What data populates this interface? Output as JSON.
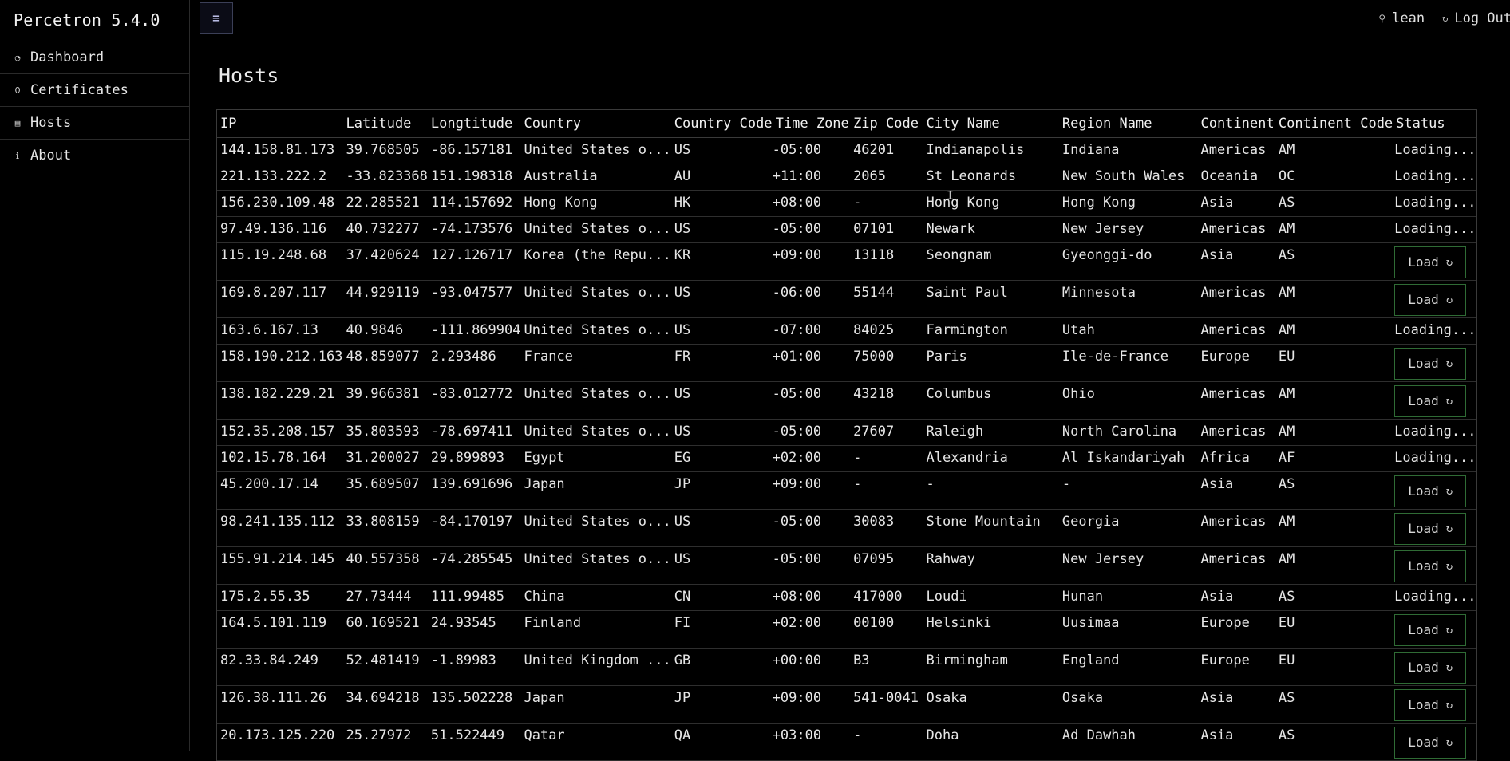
{
  "app": {
    "title": "Percetron 5.4.0"
  },
  "sidebar": {
    "items": [
      {
        "label": "Dashboard",
        "icon": "dashboard-icon"
      },
      {
        "label": "Certificates",
        "icon": "certificate-icon"
      },
      {
        "label": "Hosts",
        "icon": "list-icon"
      },
      {
        "label": "About",
        "icon": "info-icon"
      }
    ]
  },
  "header": {
    "menu_icon": "hamburger-icon",
    "username": "lean",
    "logout_label": "Log Out"
  },
  "page": {
    "title": "Hosts"
  },
  "table": {
    "columns": [
      "IP",
      "Latitude",
      "Longtitude",
      "Country",
      "Country Code",
      "Time Zone",
      "Zip Code",
      "City Name",
      "Region Name",
      "Continent",
      "Continent Code",
      "Status"
    ],
    "load_label": "Load",
    "loading_label": "Loading...",
    "rows": [
      {
        "ip": "144.158.81.173",
        "lat": "39.768505",
        "lon": "-86.157181",
        "country": "United States o...",
        "cc": "US",
        "tz": "-05:00",
        "zip": "46201",
        "city": "Indianapolis",
        "region": "Indiana",
        "continent": "Americas",
        "ctc": "AM",
        "status": "loading"
      },
      {
        "ip": "221.133.222.2",
        "lat": "-33.823368",
        "lon": "151.198318",
        "country": "Australia",
        "cc": "AU",
        "tz": "+11:00",
        "zip": "2065",
        "city": "St Leonards",
        "region": "New South Wales",
        "continent": "Oceania",
        "ctc": "OC",
        "status": "loading"
      },
      {
        "ip": "156.230.109.48",
        "lat": "22.285521",
        "lon": "114.157692",
        "country": "Hong Kong",
        "cc": "HK",
        "tz": "+08:00",
        "zip": "-",
        "city": "Hong Kong",
        "region": "Hong Kong",
        "continent": "Asia",
        "ctc": "AS",
        "status": "loading"
      },
      {
        "ip": "97.49.136.116",
        "lat": "40.732277",
        "lon": "-74.173576",
        "country": "United States o...",
        "cc": "US",
        "tz": "-05:00",
        "zip": "07101",
        "city": "Newark",
        "region": "New Jersey",
        "continent": "Americas",
        "ctc": "AM",
        "status": "loading"
      },
      {
        "ip": "115.19.248.68",
        "lat": "37.420624",
        "lon": "127.126717",
        "country": "Korea (the Repu...",
        "cc": "KR",
        "tz": "+09:00",
        "zip": "13118",
        "city": "Seongnam",
        "region": "Gyeonggi-do",
        "continent": "Asia",
        "ctc": "AS",
        "status": "load"
      },
      {
        "ip": "169.8.207.117",
        "lat": "44.929119",
        "lon": "-93.047577",
        "country": "United States o...",
        "cc": "US",
        "tz": "-06:00",
        "zip": "55144",
        "city": "Saint Paul",
        "region": "Minnesota",
        "continent": "Americas",
        "ctc": "AM",
        "status": "load"
      },
      {
        "ip": "163.6.167.13",
        "lat": "40.9846",
        "lon": "-111.869904",
        "country": "United States o...",
        "cc": "US",
        "tz": "-07:00",
        "zip": "84025",
        "city": "Farmington",
        "region": "Utah",
        "continent": "Americas",
        "ctc": "AM",
        "status": "loading"
      },
      {
        "ip": "158.190.212.163",
        "lat": "48.859077",
        "lon": "2.293486",
        "country": "France",
        "cc": "FR",
        "tz": "+01:00",
        "zip": "75000",
        "city": "Paris",
        "region": "Ile-de-France",
        "continent": "Europe",
        "ctc": "EU",
        "status": "load"
      },
      {
        "ip": "138.182.229.21",
        "lat": "39.966381",
        "lon": "-83.012772",
        "country": "United States o...",
        "cc": "US",
        "tz": "-05:00",
        "zip": "43218",
        "city": "Columbus",
        "region": "Ohio",
        "continent": "Americas",
        "ctc": "AM",
        "status": "load"
      },
      {
        "ip": "152.35.208.157",
        "lat": "35.803593",
        "lon": "-78.697411",
        "country": "United States o...",
        "cc": "US",
        "tz": "-05:00",
        "zip": "27607",
        "city": "Raleigh",
        "region": "North Carolina",
        "continent": "Americas",
        "ctc": "AM",
        "status": "loading"
      },
      {
        "ip": "102.15.78.164",
        "lat": "31.200027",
        "lon": "29.899893",
        "country": "Egypt",
        "cc": "EG",
        "tz": "+02:00",
        "zip": "-",
        "city": "Alexandria",
        "region": "Al Iskandariyah",
        "continent": "Africa",
        "ctc": "AF",
        "status": "loading"
      },
      {
        "ip": "45.200.17.14",
        "lat": "35.689507",
        "lon": "139.691696",
        "country": "Japan",
        "cc": "JP",
        "tz": "+09:00",
        "zip": "-",
        "city": "-",
        "region": "-",
        "continent": "Asia",
        "ctc": "AS",
        "status": "load"
      },
      {
        "ip": "98.241.135.112",
        "lat": "33.808159",
        "lon": "-84.170197",
        "country": "United States o...",
        "cc": "US",
        "tz": "-05:00",
        "zip": "30083",
        "city": "Stone Mountain",
        "region": "Georgia",
        "continent": "Americas",
        "ctc": "AM",
        "status": "load"
      },
      {
        "ip": "155.91.214.145",
        "lat": "40.557358",
        "lon": "-74.285545",
        "country": "United States o...",
        "cc": "US",
        "tz": "-05:00",
        "zip": "07095",
        "city": "Rahway",
        "region": "New Jersey",
        "continent": "Americas",
        "ctc": "AM",
        "status": "load"
      },
      {
        "ip": "175.2.55.35",
        "lat": "27.73444",
        "lon": "111.99485",
        "country": "China",
        "cc": "CN",
        "tz": "+08:00",
        "zip": "417000",
        "city": "Loudi",
        "region": "Hunan",
        "continent": "Asia",
        "ctc": "AS",
        "status": "loading"
      },
      {
        "ip": "164.5.101.119",
        "lat": "60.169521",
        "lon": "24.93545",
        "country": "Finland",
        "cc": "FI",
        "tz": "+02:00",
        "zip": "00100",
        "city": "Helsinki",
        "region": "Uusimaa",
        "continent": "Europe",
        "ctc": "EU",
        "status": "load"
      },
      {
        "ip": "82.33.84.249",
        "lat": "52.481419",
        "lon": "-1.89983",
        "country": "United Kingdom ...",
        "cc": "GB",
        "tz": "+00:00",
        "zip": "B3",
        "city": "Birmingham",
        "region": "England",
        "continent": "Europe",
        "ctc": "EU",
        "status": "load"
      },
      {
        "ip": "126.38.111.26",
        "lat": "34.694218",
        "lon": "135.502228",
        "country": "Japan",
        "cc": "JP",
        "tz": "+09:00",
        "zip": "541-0041",
        "city": "Osaka",
        "region": "Osaka",
        "continent": "Asia",
        "ctc": "AS",
        "status": "load"
      },
      {
        "ip": "20.173.125.220",
        "lat": "25.27972",
        "lon": "51.522449",
        "country": "Qatar",
        "cc": "QA",
        "tz": "+03:00",
        "zip": "-",
        "city": "Doha",
        "region": "Ad Dawhah",
        "continent": "Asia",
        "ctc": "AS",
        "status": "load"
      }
    ]
  }
}
